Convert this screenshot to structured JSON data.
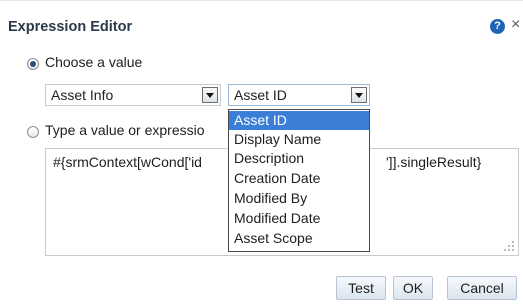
{
  "dialog": {
    "title": "Expression Editor",
    "help_icon_glyph": "?",
    "close_icon_glyph": "×"
  },
  "choose": {
    "label": "Choose a value",
    "category_value": "Asset Info",
    "field_value": "Asset ID"
  },
  "type_value": {
    "label": "Type a value or expressio",
    "text_left": "#{srmContext[wCond['id",
    "text_right": "']].singleResult}"
  },
  "dropdown": {
    "options": [
      "Asset ID",
      "Display Name",
      "Description",
      "Creation Date",
      "Modified By",
      "Modified Date",
      "Asset Scope"
    ],
    "selected": "Asset ID",
    "highlight_color": "#3a7ed8"
  },
  "buttons": {
    "test": "Test",
    "ok": "OK",
    "cancel": "Cancel"
  },
  "icons": {
    "help": "help-icon",
    "close": "close-icon",
    "dropdown_arrow": "chevron-down-icon",
    "resize": "resize-grip-icon"
  },
  "colors": {
    "title": "#2b3a4a",
    "help_icon": "#1f64b5",
    "button_border": "#b7c4d3"
  }
}
